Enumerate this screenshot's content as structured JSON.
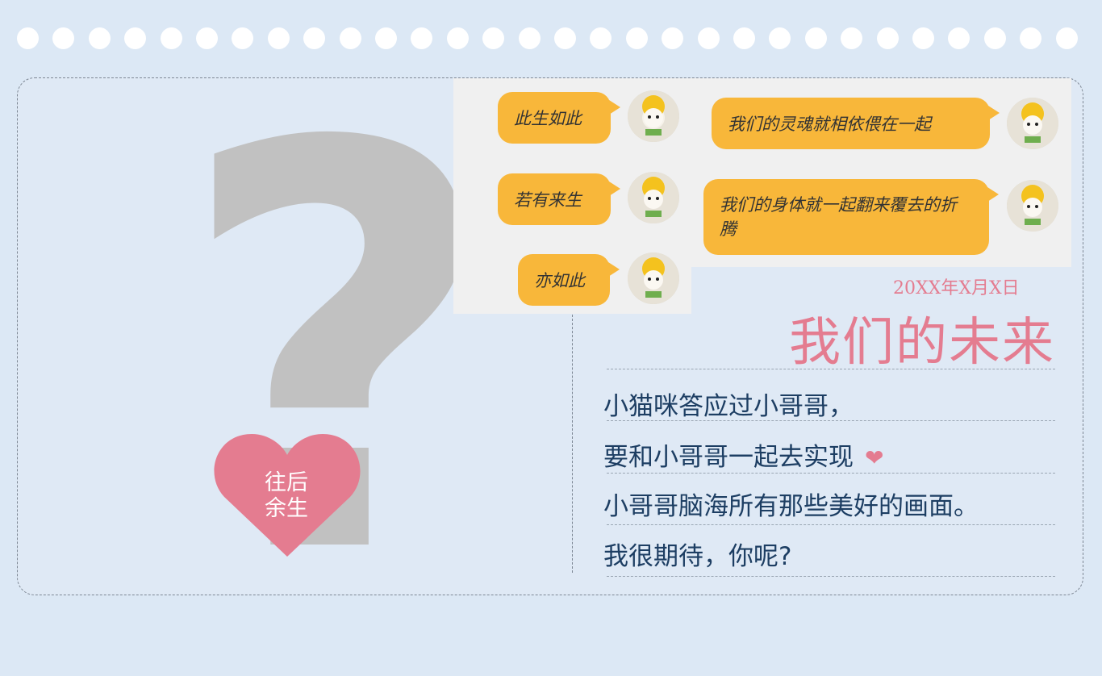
{
  "chat": {
    "left_messages": [
      "此生如此",
      "若有来生",
      "亦如此"
    ],
    "right_messages": [
      "我们的灵魂就相依偎在一起",
      "我们的身体就一起翻来覆去的折腾"
    ]
  },
  "heart_label": "往后\n余生",
  "date": "20XX年X月X日",
  "title": "我们的未来",
  "lines": [
    "小猫咪答应过小哥哥，",
    "要和小哥哥一起去实现",
    "小哥哥脑海所有那些美好的画面。",
    "我很期待，你呢?"
  ],
  "colors": {
    "background": "#dce8f5",
    "accent_pink": "#e47c90",
    "bubble": "#f8b73a",
    "text_blue": "#1d3e63"
  },
  "icons": {
    "heart": "heart-icon",
    "avatar": "cat-flower-avatar"
  }
}
